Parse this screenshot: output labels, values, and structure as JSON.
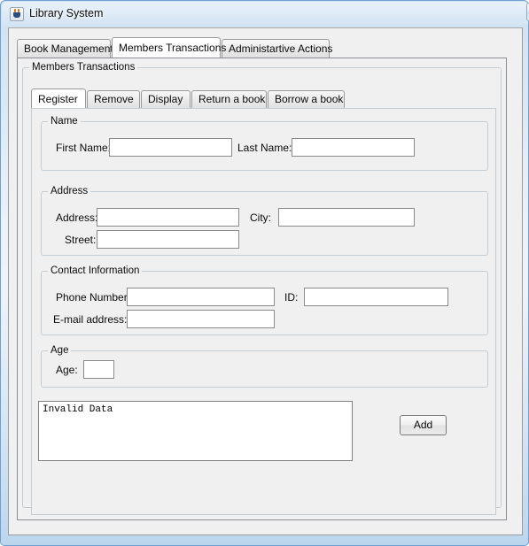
{
  "window": {
    "title": "Library System",
    "app_icon": "java-coffee-cup-icon",
    "controls": {
      "minimize": "minimize-icon",
      "maximize": "restore-icon",
      "close_label": "✕"
    }
  },
  "outer_tabs": {
    "selected_index": 1,
    "items": [
      {
        "label": "Book Management"
      },
      {
        "label": "Members Transactions"
      },
      {
        "label": "Administartive Actions"
      }
    ]
  },
  "members_panel": {
    "group_title": "Members Transactions",
    "inner_tabs": {
      "selected_index": 0,
      "items": [
        {
          "label": "Register"
        },
        {
          "label": "Remove"
        },
        {
          "label": "Display"
        },
        {
          "label": "Return a book"
        },
        {
          "label": "Borrow a book"
        }
      ]
    },
    "register_form": {
      "name_group": {
        "title": "Name",
        "first_name_label": "First Name:",
        "first_name_value": "",
        "last_name_label": "Last Name:",
        "last_name_value": ""
      },
      "address_group": {
        "title": "Address",
        "address_label": "Address:",
        "address_value": "",
        "city_label": "City:",
        "city_value": "",
        "street_label": "Street:",
        "street_value": ""
      },
      "contact_group": {
        "title": "Contact Information",
        "phone_label": "Phone Number:",
        "phone_value": "",
        "id_label": "ID:",
        "id_value": "",
        "email_label": "E-mail address:",
        "email_value": ""
      },
      "age_group": {
        "title": "Age",
        "age_label": "Age:",
        "age_value": ""
      },
      "output": {
        "text": "Invalid Data"
      },
      "add_button_label": "Add"
    }
  },
  "colors": {
    "window_frame": "#6f9fd0",
    "panel_background": "#f0f0f0",
    "field_background": "#ffffff",
    "field_border": "#8a8a8a",
    "group_border": "#c3cdd6",
    "close_button": "#c63829"
  }
}
